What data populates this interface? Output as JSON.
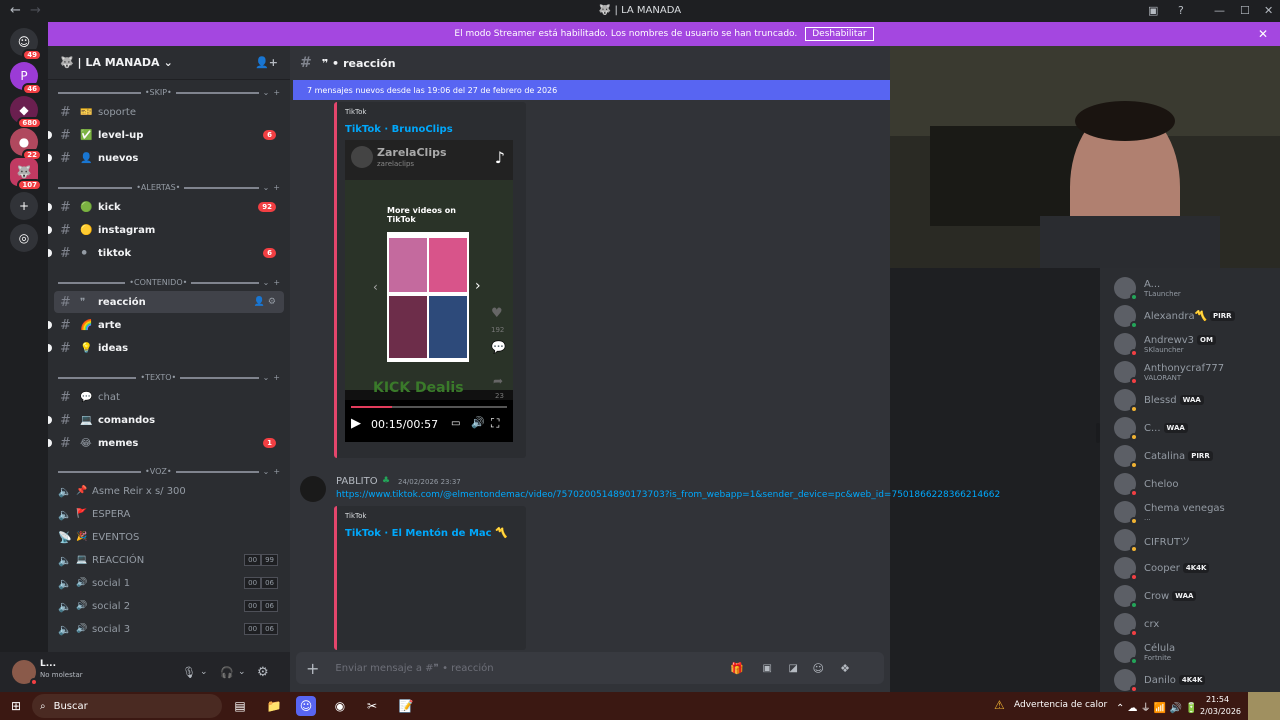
{
  "window": {
    "title": "🐺 | LA MANADA"
  },
  "guilds": [
    {
      "badge": "49"
    },
    {
      "badge": "46"
    },
    {
      "badge": "680"
    },
    {
      "badge": "22"
    },
    {
      "badge": "107"
    }
  ],
  "streamer_bar": {
    "text": "El modo Streamer está habilitado. Los nombres de usuario se han truncado.",
    "button": "Deshabilitar"
  },
  "server": {
    "name": "🐺 | LA MANADA"
  },
  "categories": {
    "skip": "•SKIP•",
    "alertas": "•ALERTAS•",
    "contenido": "•CONTENIDO•",
    "texto": "•TEXTO•",
    "voz": "•VOZ•"
  },
  "channels": {
    "soporte": {
      "name": "soporte"
    },
    "levelup": {
      "name": "level-up",
      "badge": "6"
    },
    "nuevos": {
      "name": "nuevos"
    },
    "kick": {
      "name": "kick",
      "badge": "92"
    },
    "instagram": {
      "name": "instagram"
    },
    "tiktok": {
      "name": "tiktok",
      "badge": "6"
    },
    "reaccion": {
      "name": "reacción"
    },
    "arte": {
      "name": "arte"
    },
    "ideas": {
      "name": "ideas"
    },
    "chat": {
      "name": "chat"
    },
    "comandos": {
      "name": "comandos"
    },
    "memes": {
      "name": "memes",
      "badge": "1"
    }
  },
  "voice": [
    {
      "name": "Asme Reir x s/ 300",
      "emoji": "📌"
    },
    {
      "name": "ESPERA",
      "emoji": "🚩"
    },
    {
      "name": "EVENTOS",
      "emoji": "🎉"
    },
    {
      "name": "REACCIÓN",
      "emoji": "💻",
      "count": [
        "00",
        "99"
      ]
    },
    {
      "name": "social 1",
      "emoji": "🔊",
      "count": [
        "00",
        "06"
      ]
    },
    {
      "name": "social 2",
      "emoji": "🔊",
      "count": [
        "00",
        "06"
      ]
    },
    {
      "name": "social 3",
      "emoji": "🔊",
      "count": [
        "00",
        "06"
      ]
    }
  ],
  "user": {
    "name": "L...",
    "status": "No molestar"
  },
  "header": {
    "channel": "reacción"
  },
  "new_messages": "7 mensajes nuevos desde las 19:06 del 27 de febrero de 2026",
  "embed1": {
    "provider": "TikTok",
    "title": "TikTok · BrunoClips",
    "video": {
      "account": "ZarelaClips",
      "handle": "zarelaclips",
      "more": "More videos on TikTok",
      "likes": "192",
      "shares": "23",
      "watermark": "KICK Dealis",
      "time": "00:15/00:57"
    }
  },
  "message": {
    "author": "PABLITO",
    "timestamp": "24/02/2026 23:37",
    "link": "https://www.tiktok.com/@elmentondemac/video/7570200514890173703?is_from_webapp=1&sender_device=pc&web_id=7501866228366214662"
  },
  "embed2": {
    "provider": "TikTok",
    "title": "TikTok · El Mentón de Mac 〽️"
  },
  "composer": {
    "placeholder": "Enviar mensaje a #❞ • reacción"
  },
  "members": [
    {
      "name": "A...",
      "sub": "TLauncher",
      "color": "#23a559"
    },
    {
      "name": "Alexandra〽️",
      "tag": "PIRR",
      "color": "#23a559"
    },
    {
      "name": "Andrewv3",
      "tag": "OM",
      "sub": "SKlauncher",
      "color": "#f23f43"
    },
    {
      "name": "Anthonycraf777",
      "sub": "VALORANT",
      "color": "#f23f43"
    },
    {
      "name": "Blessd",
      "tag": "WAA",
      "color": "#f0b232"
    },
    {
      "name": "C...",
      "tag": "WAA",
      "color": "#f0b232"
    },
    {
      "name": "Catalina",
      "tag": "PIRR",
      "color": "#f0b232"
    },
    {
      "name": "Cheloo",
      "color": "#f23f43"
    },
    {
      "name": "Chema venegas",
      "sub": "...",
      "color": "#f0b232"
    },
    {
      "name": "CIFRUTツ",
      "color": "#f0b232"
    },
    {
      "name": "Cooper",
      "tag": "4K4K",
      "color": "#f23f43"
    },
    {
      "name": "Crow",
      "tag": "WAA",
      "color": "#23a559"
    },
    {
      "name": "crx",
      "color": "#f23f43"
    },
    {
      "name": "Célula",
      "sub": "Fortnite",
      "color": "#23a559"
    },
    {
      "name": "Danilo",
      "tag": "4K4K",
      "color": "#f23f43"
    }
  ],
  "taskbar": {
    "search": "Buscar",
    "alert": "Advertencia de calor",
    "time": "21:54",
    "date": "2/03/2026"
  }
}
